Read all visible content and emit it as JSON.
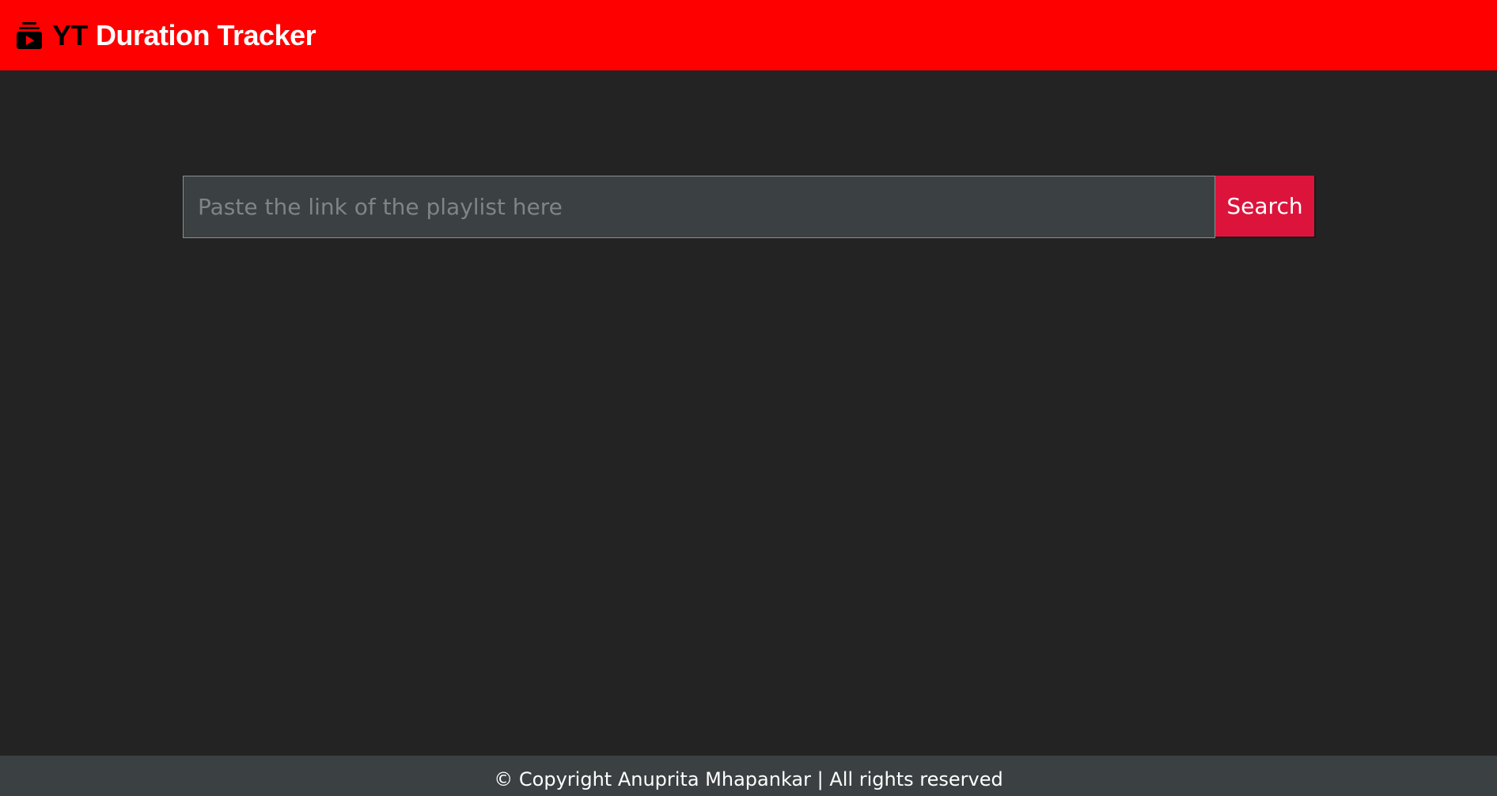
{
  "header": {
    "brand_prefix": "YT",
    "brand_name": "Duration Tracker",
    "icon": "playlist-play-icon",
    "background_color": "#ff0000"
  },
  "search": {
    "placeholder": "Paste the link of the playlist here",
    "value": "",
    "button_label": "Search",
    "button_color": "#dc143c"
  },
  "footer": {
    "text": "© Copyright Anuprita Mhapankar | All rights reserved"
  }
}
